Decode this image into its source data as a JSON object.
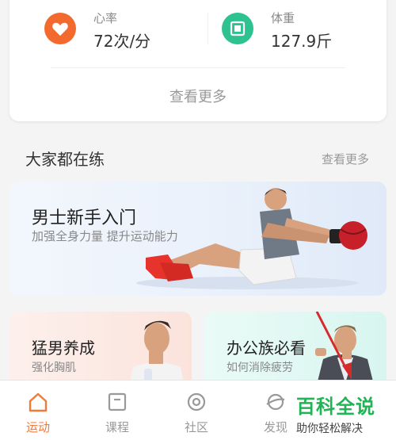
{
  "stats": {
    "heart": {
      "label": "心率",
      "value": "72次/分",
      "icon": "heart-icon",
      "color": "#f26a2e"
    },
    "weight": {
      "label": "体重",
      "value": "127.9斤",
      "icon": "scale-icon",
      "color": "#2dc28f"
    },
    "more": "查看更多"
  },
  "section": {
    "title": "大家都在练",
    "more": "查看更多"
  },
  "banner": {
    "title": "男士新手入门",
    "subtitle": "加强全身力量 提升运动能力"
  },
  "cards": [
    {
      "title": "猛男养成",
      "subtitle": "强化胸肌"
    },
    {
      "title": "办公族必看",
      "subtitle": "如何消除疲劳"
    }
  ],
  "tabs": [
    {
      "label": "运动",
      "icon": "home-icon",
      "active": true
    },
    {
      "label": "课程",
      "icon": "course-icon",
      "active": false
    },
    {
      "label": "社区",
      "icon": "community-icon",
      "active": false
    },
    {
      "label": "发现",
      "icon": "discover-icon",
      "active": false
    }
  ],
  "watermark": {
    "title": "百科全说",
    "subtitle": "助你轻松解决"
  },
  "colors": {
    "accent": "#f07a3a",
    "watermark": "#1fb454"
  }
}
